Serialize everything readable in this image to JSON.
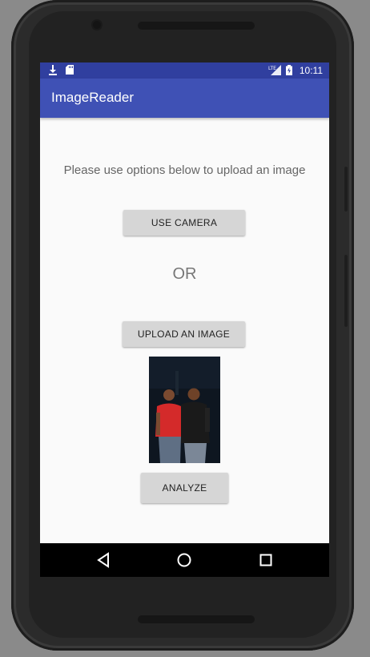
{
  "status_bar": {
    "time": "10:11",
    "icons": [
      "download-icon",
      "sd-card-icon",
      "lte-signal-icon",
      "battery-icon"
    ],
    "background": "#303f9f"
  },
  "app_bar": {
    "title": "ImageReader",
    "background": "#3f51b5"
  },
  "main": {
    "instruction": "Please use options below to upload an image",
    "camera_button_label": "USE CAMERA",
    "or_text": "OR",
    "upload_button_label": "UPLOAD AN IMAGE",
    "analyze_button_label": "ANALYZE"
  },
  "nav_bar": {
    "icons": [
      "back-icon",
      "home-icon",
      "recents-icon"
    ]
  }
}
